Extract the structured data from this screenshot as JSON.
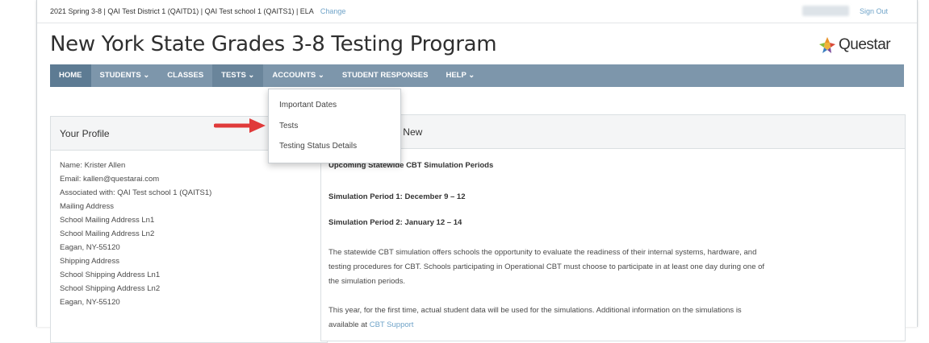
{
  "topbar": {
    "context": "2021 Spring 3-8  |  QAI Test District 1 (QAITD1)  |  QAI Test school 1 (QAITS1)  |  ELA",
    "change_link": "Change",
    "sign_out": "Sign Out"
  },
  "header": {
    "title": "New York State Grades 3-8 Testing Program",
    "logo_text": "Questar",
    "logo_icon": "questar-logo-icon"
  },
  "nav": {
    "items": [
      {
        "label": "HOME",
        "state": "active"
      },
      {
        "label": "STUDENTS ⌄"
      },
      {
        "label": "CLASSES"
      },
      {
        "label": "TESTS ⌄",
        "state": "open"
      },
      {
        "label": "ACCOUNTS ⌄"
      },
      {
        "label": "STUDENT RESPONSES"
      },
      {
        "label": "HELP ⌄"
      }
    ]
  },
  "tests_menu": {
    "items": [
      "Important Dates",
      "Tests",
      "Testing Status Details"
    ]
  },
  "annotation": {
    "icon": "red-arrow-icon",
    "color": "#e03a3a"
  },
  "profile": {
    "title": "Your Profile",
    "lines": [
      "Name: Krister Allen",
      "Email: kallen@questarai.com",
      "Associated with: QAI Test school 1 (QAITS1)",
      "Mailing Address",
      "School Mailing Address Ln1",
      "School Mailing Address Ln2",
      "Eagan, NY-55120",
      "Shipping Address",
      "School Shipping Address Ln1",
      "School Shipping Address Ln2",
      "Eagan, NY-55120"
    ]
  },
  "news": {
    "title": "hat's New",
    "heading": "Upcoming Statewide CBT Simulation Periods",
    "period1": "Simulation Period 1: December 9 – 12",
    "period2": "Simulation Period 2: January 12 – 14",
    "para1_l1": "The statewide CBT simulation offers schools the opportunity to evaluate the readiness of their internal systems, hardware, and",
    "para1_l2": "testing procedures for CBT. Schools participating in Operational CBT must choose to participate in at least one day during one of",
    "para1_l3": "the simulation periods.",
    "para2_l1": "This year, for the first time, actual student data will be used for the simulations. Additional information on the simulations is",
    "para2_l2_start": "available at ",
    "para2_link": "CBT Support"
  },
  "colors": {
    "nav_bg": "#7d96ab",
    "nav_active": "#5d7b93",
    "link": "#6fa3c8",
    "arrow": "#e03a3a"
  }
}
